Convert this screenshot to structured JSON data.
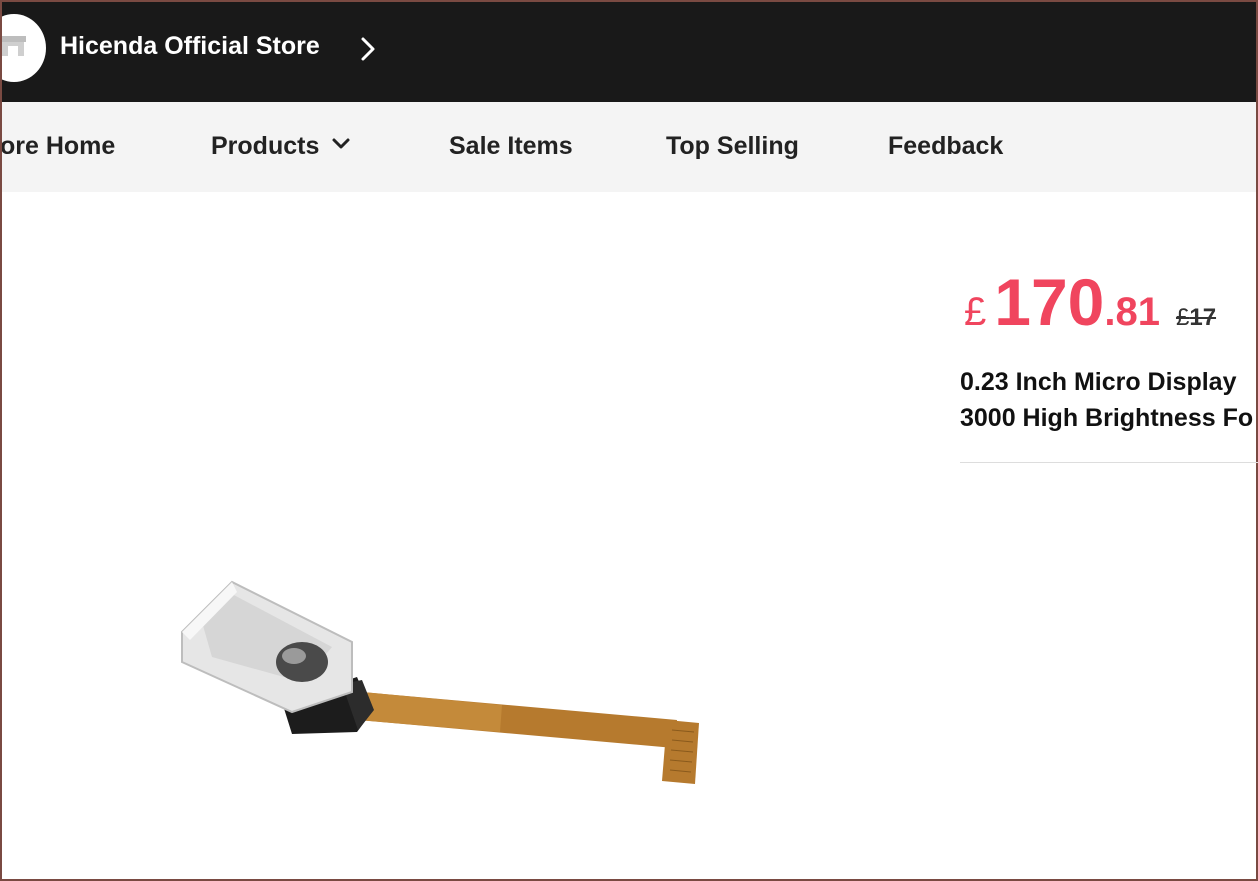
{
  "store": {
    "name": "Hicenda Official Store"
  },
  "nav": {
    "items": [
      {
        "label": "ore Home"
      },
      {
        "label": "Products"
      },
      {
        "label": "Sale Items"
      },
      {
        "label": "Top Selling"
      },
      {
        "label": "Feedback"
      }
    ]
  },
  "product": {
    "currency": "£",
    "price_integer": "170",
    "price_decimal": ".81",
    "old_price_currency": "£",
    "old_price_visible": "17",
    "title_line1": "0.23 Inch Micro Display",
    "title_line2": "3000 High Brightness Fo"
  },
  "colors": {
    "header_bg": "#191919",
    "nav_bg": "#f4f4f4",
    "price": "#f0455e"
  },
  "icons": {
    "store_logo": "store-icon",
    "header_chevron": "chevron-right-icon",
    "products_dropdown": "chevron-down-icon"
  }
}
